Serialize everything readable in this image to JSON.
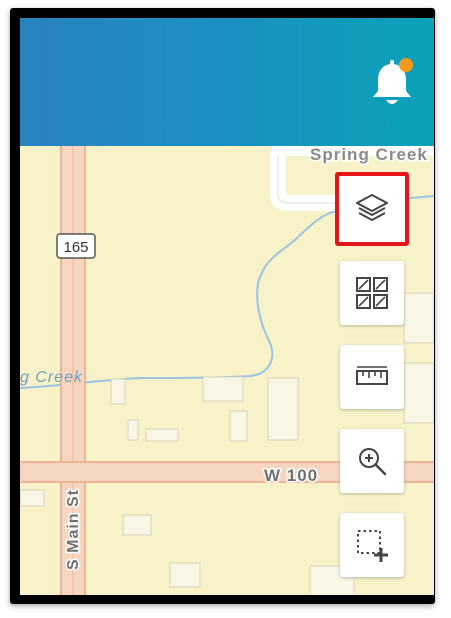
{
  "map": {
    "road_shield": "165",
    "street_labels": [
      "Spring Creek",
      "W 100",
      "S Main St"
    ],
    "water_label": "g Creek"
  },
  "header": {
    "notification_icon": "bell-icon",
    "notification_badge_color": "#f39b1a"
  },
  "toolbar": {
    "buttons": [
      {
        "name": "layers-button",
        "icon": "layers-icon",
        "selected": true
      },
      {
        "name": "basemap-gallery-button",
        "icon": "grid-gallery-icon",
        "selected": false
      },
      {
        "name": "measure-button",
        "icon": "ruler-icon",
        "selected": false
      },
      {
        "name": "zoom-in-button",
        "icon": "zoom-in-icon",
        "selected": false
      },
      {
        "name": "select-area-button",
        "icon": "select-add-icon",
        "selected": false
      }
    ]
  },
  "colors": {
    "header_start": "#2a83bf",
    "header_end": "#0aa3b8",
    "map_background": "#f7f2c8",
    "road": "#f2c4a4",
    "water": "#9ac4e6",
    "highlight": "#e4141b"
  }
}
